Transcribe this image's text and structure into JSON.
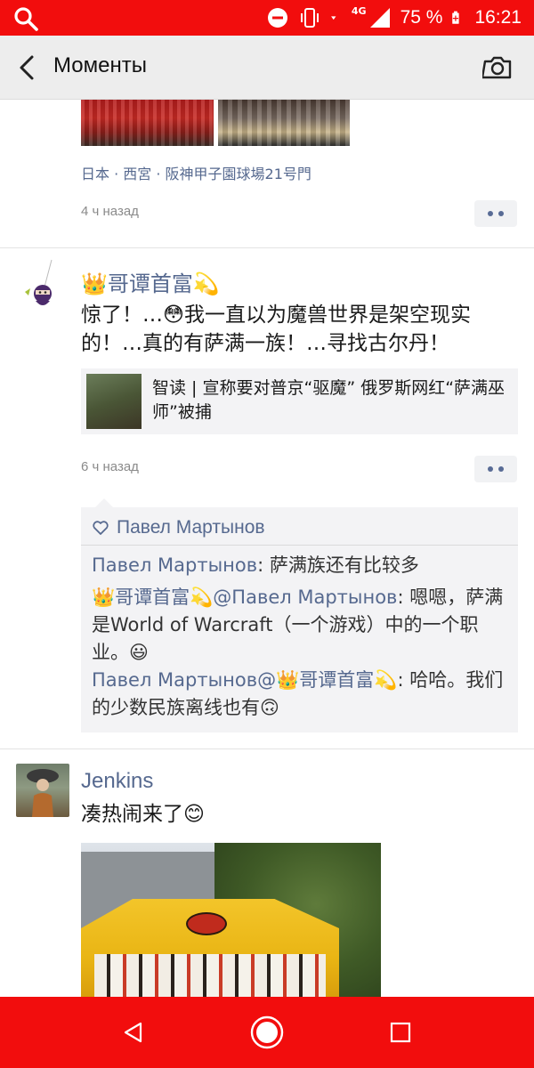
{
  "status_bar": {
    "network": "4G",
    "battery": "75 %",
    "time": "16:21",
    "color": "#f20d0d"
  },
  "header": {
    "title": "Моменты"
  },
  "post1": {
    "location": "日本 · 西宮 · 阪神甲子園球場21号門",
    "time": "4 ч назад"
  },
  "post2": {
    "username": "👑哥谭首富💫",
    "text": "惊了！…😳我一直以为魔兽世界是架空现实的！…真的有萨满一族！…寻找古尔丹！",
    "link_title": "智读 | 宣称要对普京“驱魔” 俄罗斯网红“萨满巫师”被捕",
    "time": "6 ч назад",
    "likes": "Павел Мартынов",
    "comments": [
      {
        "author": "Павел Мартынов",
        "body": ": 萨满族还有比较多"
      },
      {
        "author": "👑哥谭首富💫@Павел Мартынов",
        "body": ": 嗯嗯，萨满是World of Warcraft（一个游戏）中的一个职业。😃"
      },
      {
        "author": "Павел Мартынов@👑哥谭首富💫",
        "body": ": 哈哈。我们的少数民族离线也有🙃"
      }
    ]
  },
  "post3": {
    "username": "Jenkins",
    "text": "凑热闹来了😊"
  },
  "colors": {
    "accent_red": "#f20d0d",
    "link_blue": "#56698f"
  }
}
